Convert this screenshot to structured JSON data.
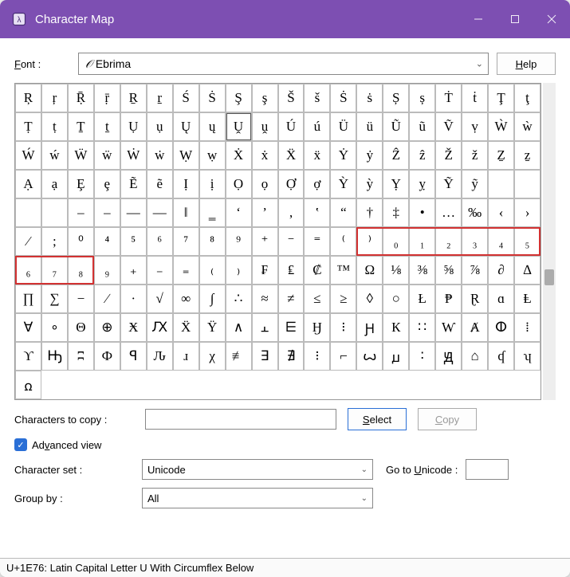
{
  "titlebar": {
    "title": "Character Map"
  },
  "labels": {
    "font": "Font :",
    "help": "Help",
    "chars_to_copy": "Characters to copy :",
    "select": "Select",
    "copy": "Copy",
    "advanced_view": "Advanced view",
    "charset": "Character set :",
    "goto_unicode": "Go to Unicode :",
    "group_by": "Group by :"
  },
  "font": {
    "value": "Ebrima",
    "glyph": "𝒪"
  },
  "charset": {
    "value": "Unicode"
  },
  "group_by": {
    "value": "All"
  },
  "copy_value": "",
  "advanced_checked": true,
  "status": "U+1E76: Latin Capital Letter U With Circumflex Below",
  "selected_index": 28,
  "grid": [
    "Ŗ",
    "ŗ",
    "Ṝ",
    "ṝ",
    "Ṟ",
    "ṟ",
    "Ś",
    "Ṡ",
    "Ş",
    "ş",
    "Š",
    "š",
    "Ṡ",
    "ṡ",
    "Ș",
    "ș",
    "Ṫ",
    "ṫ",
    "Ţ",
    "ţ",
    "Ṭ",
    "ṭ",
    "Ṯ",
    "ṯ",
    "Ụ",
    "ụ",
    "Ų",
    "ų",
    "Ṷ",
    "ṷ",
    "Ú",
    "ú",
    "Ü",
    "ü",
    "Ũ",
    "ũ",
    "Ṽ",
    "ṿ",
    "Ẁ",
    "ẁ",
    "Ẃ",
    "ẃ",
    "Ẅ",
    "ẅ",
    "Ẇ",
    "ẇ",
    "Ẉ",
    "ẉ",
    "Ẋ",
    "ẋ",
    "Ẍ",
    "ẍ",
    "Ẏ",
    "ẏ",
    "Ẑ",
    "ẑ",
    "Ž",
    "ž",
    "Ẕ",
    "ẕ",
    "Ạ",
    "ạ",
    "Ȩ",
    "ȩ",
    "Ẽ",
    "ẽ",
    "Ị",
    "ị",
    "Ọ",
    "ọ",
    "Ợ",
    "ợ",
    "Ỳ",
    "ỳ",
    "Ỵ",
    "ỵ",
    "Ỹ",
    "ỹ",
    "",
    "",
    "",
    "",
    "‒",
    "–",
    "—",
    "―",
    "‖",
    "‗",
    "‘",
    "’",
    "‚",
    "‛",
    "“",
    "†",
    "‡",
    "•",
    "…",
    "‰",
    "‹",
    "›",
    "⁄",
    ";",
    "⁰",
    "⁴",
    "⁵",
    "⁶",
    "⁷",
    "⁸",
    "⁹",
    "⁺",
    "⁻",
    "⁼",
    "⁽",
    "⁾",
    "₀",
    "₁",
    "₂",
    "₃",
    "₄",
    "₅",
    "₆",
    "₇",
    "₈",
    "₉",
    "₊",
    "₋",
    "₌",
    "₍",
    "₎",
    "₣",
    "₤",
    "₡",
    "™",
    "Ω",
    "⅛",
    "⅜",
    "⅝",
    "⅞",
    "∂",
    "∆",
    "∏",
    "∑",
    "−",
    "∕",
    "∙",
    "√",
    "∞",
    "∫",
    "∴",
    "≈",
    "≠",
    "≤",
    "≥",
    "◊",
    "○",
    "Ł",
    "₱",
    "Ɽ",
    "ɑ",
    "Ⱡ",
    "∀",
    "∘",
    "Θ",
    "⊕",
    "Ӿ",
    "Ԕ",
    "Ẍ",
    "Ÿ",
    "∧",
    "⫠",
    "⋿",
    "Ӈ",
    "⁝",
    "Ԩ",
    "К",
    "∷",
    "Ⱳ",
    "Ⱥ",
    "ⵀ",
    "⁞",
    "ϒ",
    "Ԣ",
    "ʭ",
    "Ф",
    "ꟼ",
    "Ԉ",
    "ɹ",
    "χ",
    "≢",
    "∃",
    "∄",
    "⁝",
    "⌐",
    "ꙍ",
    "ꙡ",
    "∶",
    "Ԭ",
    "⌂",
    "ʠ",
    "ʮ",
    "ꭥ"
  ]
}
